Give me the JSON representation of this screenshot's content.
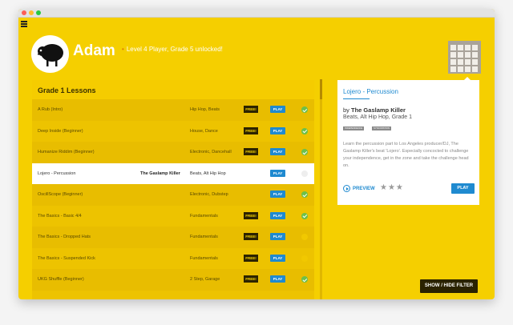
{
  "window": {
    "colors": {
      "accent": "#f5cf00",
      "blue": "#1f8ad0",
      "dark": "#2a2200",
      "check": "#6cc04a"
    }
  },
  "header": {
    "user_name": "Adam",
    "status": "Level 4 Player, Grade 5 unlocked!"
  },
  "lessons": {
    "title": "Grade 1 Lessons",
    "free_label": "FREE!",
    "play_label": "PLAY",
    "rows": [
      {
        "name": "A Rub (Intro)",
        "artist": "",
        "genre": "Hip Hop, Beats",
        "free": true,
        "completed": true,
        "selected": false
      },
      {
        "name": "Deep Inside (Beginner)",
        "artist": "",
        "genre": "House, Dance",
        "free": true,
        "completed": true,
        "selected": false
      },
      {
        "name": "Humanize Riddim (Beginner)",
        "artist": "",
        "genre": "Electronic, Dancehall",
        "free": true,
        "completed": true,
        "selected": false
      },
      {
        "name": "Lojero - Percussion",
        "artist": "The Gaslamp Killer",
        "genre": "Beats, Alt Hip Hop",
        "free": false,
        "completed": false,
        "selected": true
      },
      {
        "name": "OscillScope (Beginner)",
        "artist": "",
        "genre": "Electronic, Dubstep",
        "free": false,
        "completed": true,
        "selected": false
      },
      {
        "name": "The Basics - Basic 4/4",
        "artist": "",
        "genre": "Fundamentals",
        "free": true,
        "completed": true,
        "selected": false
      },
      {
        "name": "The Basics - Dropped Hats",
        "artist": "",
        "genre": "Fundamentals",
        "free": true,
        "completed": false,
        "selected": false
      },
      {
        "name": "The Basics - Suspended Kick",
        "artist": "",
        "genre": "Fundamentals",
        "free": true,
        "completed": false,
        "selected": false
      },
      {
        "name": "UKG Shuffle (Beginner)",
        "artist": "",
        "genre": "2 Step, Garage",
        "free": true,
        "completed": true,
        "selected": false
      }
    ]
  },
  "detail": {
    "title": "Lojero - Percussion",
    "by_prefix": "by",
    "artist": "The Gaslamp Killer",
    "tags_line": "Beats, Alt Hip Hop, Grade 1",
    "badges": [
      "INDEPENDENCE",
      "SYNCOPATION"
    ],
    "description": "Learn the percussion part to Los Angeles producer/DJ, The Gaslamp Killer's beat 'Lojero'. Especially concocted to challenge your independence, get in the zone and take the challenge head on.",
    "preview_label": "PREVIEW",
    "rating_stars": "★★★",
    "rating": 3,
    "play_label": "PLAY"
  },
  "filter_button": "SHOW / HIDE FILTER"
}
